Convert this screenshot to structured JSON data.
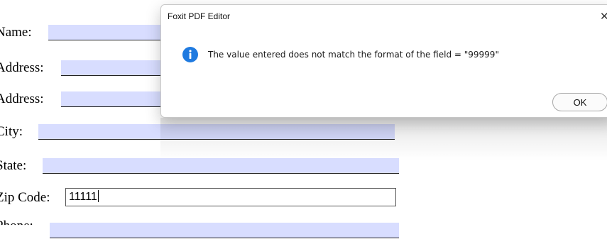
{
  "form": {
    "name_label": "Name:",
    "address1_label": "Address:",
    "address2_label": "Address:",
    "city_label": "City:",
    "state_label": "State:",
    "zip_label": "Zip Code:",
    "zip_value": "11111",
    "phone_label": "Phone:"
  },
  "dialog": {
    "title": "Foxit PDF Editor",
    "close_glyph": "✕",
    "message": "The value entered does not match the format of the field = \"99999\"",
    "ok_label": "OK",
    "icon": "info-icon"
  },
  "colors": {
    "field_fill": "#d8ddff",
    "info_blue": "#1f7ae0"
  }
}
